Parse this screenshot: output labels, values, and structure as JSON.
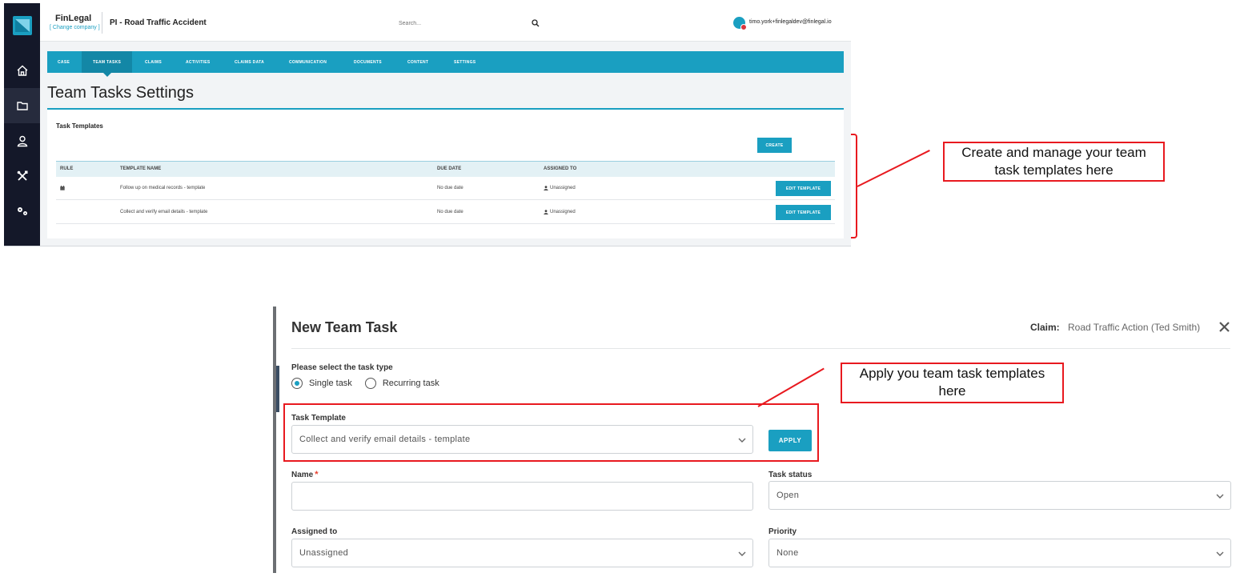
{
  "top_app": {
    "brand": {
      "name": "FinLegal",
      "change_company": "[ Change company ]"
    },
    "case_title": "PI - Road Traffic Accident",
    "search": {
      "placeholder": "Search..."
    },
    "user_email": "timo.york+finlegaldev@finlegal.io",
    "sidebar": [
      {
        "name": "home-icon"
      },
      {
        "name": "folder-icon",
        "active": true
      },
      {
        "name": "user-icon"
      },
      {
        "name": "tools-icon"
      },
      {
        "name": "gears-icon"
      }
    ],
    "tabs": [
      {
        "label": "CASE"
      },
      {
        "label": "TEAM TASKS",
        "active": true
      },
      {
        "label": "CLAIMS"
      },
      {
        "label": "ACTIVITIES"
      },
      {
        "label": "CLAIMS DATA"
      },
      {
        "label": "COMMUNICATION"
      },
      {
        "label": "DOCUMENTS"
      },
      {
        "label": "CONTENT"
      },
      {
        "label": "SETTINGS"
      }
    ],
    "page_title": "Team Tasks Settings",
    "card": {
      "heading": "Task Templates",
      "create_label": "CREATE",
      "columns": {
        "rule": "RULE",
        "template_name": "TEMPLATE NAME",
        "due_date": "DUE DATE",
        "assigned_to": "ASSIGNED TO"
      },
      "rows": [
        {
          "rule_icon": "calendar-icon",
          "template_name": "Follow up on medical records - template",
          "due_date": "No due date",
          "assigned_to": "Unassigned",
          "action": "EDIT TEMPLATE"
        },
        {
          "rule_icon": "",
          "template_name": "Collect and verify email details - template",
          "due_date": "No due date",
          "assigned_to": "Unassigned",
          "action": "EDIT TEMPLATE"
        }
      ]
    }
  },
  "callouts": {
    "manage": "Create and manage your team task templates here",
    "apply": "Apply you team task templates here"
  },
  "modal": {
    "title": "New Team Task",
    "claim_label": "Claim:",
    "claim_value": "Road Traffic Action (Ted Smith)",
    "task_type_label": "Please select the task type",
    "task_types": [
      {
        "label": "Single task",
        "selected": true
      },
      {
        "label": "Recurring task",
        "selected": false
      }
    ],
    "template_label": "Task Template",
    "template_value": "Collect and verify email details - template",
    "apply_label": "APPLY",
    "name_label": "Name",
    "name_required": "*",
    "name_value": "",
    "status_label": "Task status",
    "status_value": "Open",
    "assigned_label": "Assigned to",
    "assigned_value": "Unassigned",
    "priority_label": "Priority",
    "priority_value": "None"
  },
  "colors": {
    "accent": "#1a9fc1",
    "sidebar": "#141829",
    "annotation": "#e8191f"
  }
}
